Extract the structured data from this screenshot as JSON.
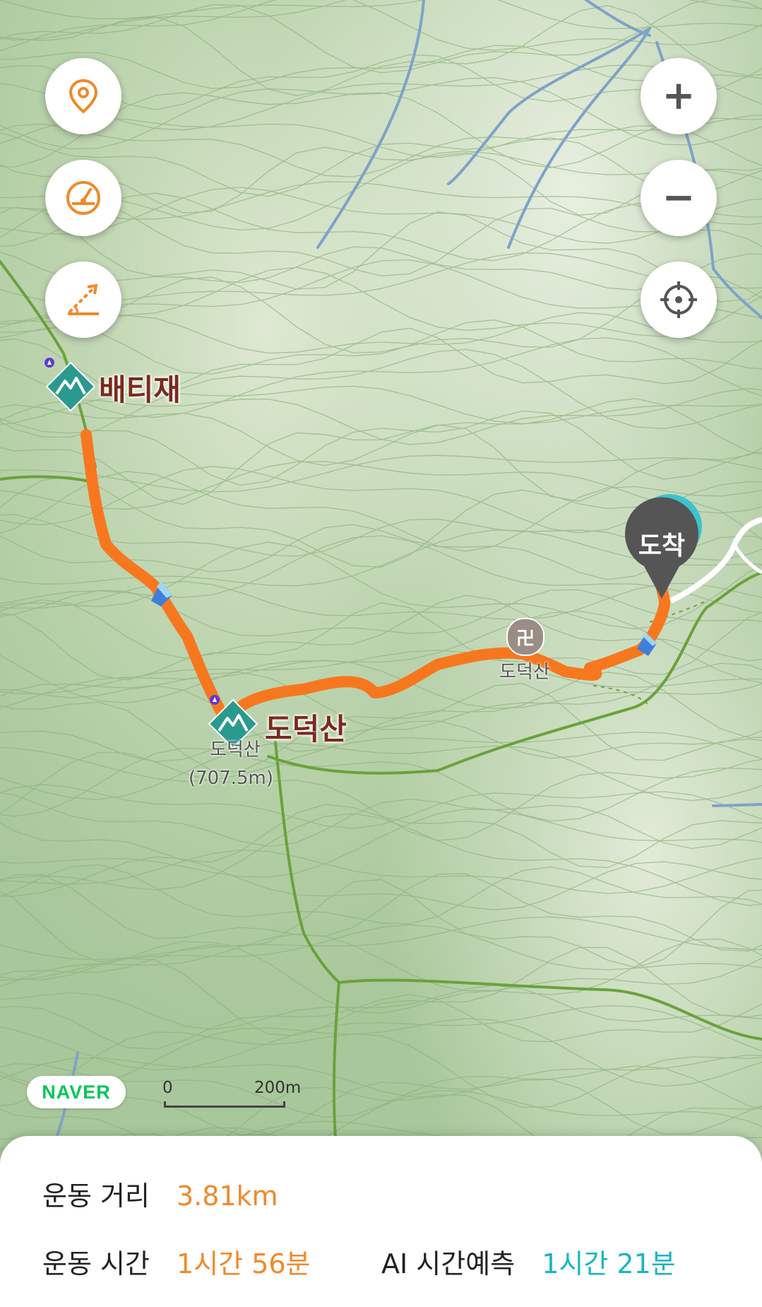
{
  "map": {
    "peaks": [
      {
        "name": "배티재"
      },
      {
        "name": "도덕산",
        "sub_name": "도덕산",
        "sub_elev": "(707.5m)"
      }
    ],
    "temple_label": "도덕산",
    "arrival_label": "도착",
    "naver_logo": "NAVER",
    "scale": {
      "start": "0",
      "end": "200m"
    },
    "colors": {
      "route": "#f7771f",
      "trail": "#6aa23c",
      "stream": "#7ea3c8",
      "arrival": "#555555",
      "arrival_ring": "#3cc3cf"
    }
  },
  "controls": {
    "left": [
      {
        "icon": "location-pin-icon"
      },
      {
        "icon": "speedometer-icon"
      },
      {
        "icon": "slope-icon"
      }
    ],
    "right": [
      {
        "icon": "zoom-in-icon",
        "glyph": "+"
      },
      {
        "icon": "zoom-out-icon",
        "glyph": "−"
      },
      {
        "icon": "crosshair-icon"
      }
    ]
  },
  "stats": {
    "distance_label": "운동 거리",
    "distance_value": "3.81km",
    "time_label": "운동 시간",
    "time_value": "1시간 56분",
    "ai_label": "AI 시간예측",
    "ai_value": "1시간 21분"
  }
}
